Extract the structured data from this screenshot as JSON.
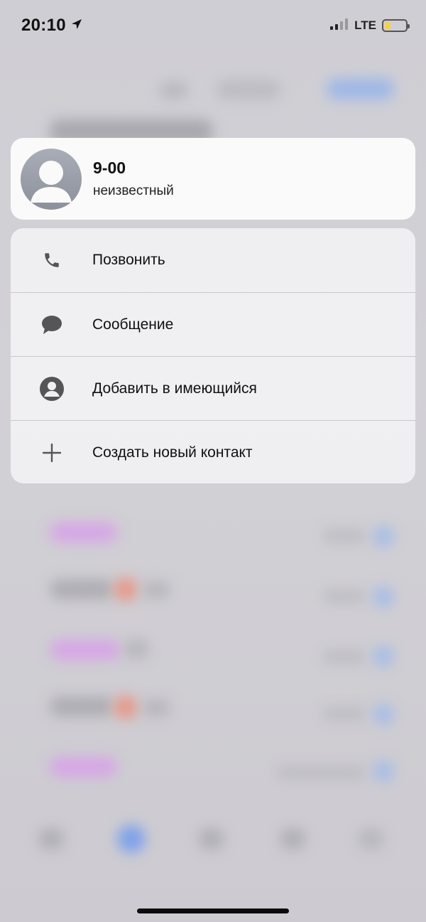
{
  "status": {
    "time": "20:10",
    "network": "LTE",
    "battery_level": 0.28,
    "icons": [
      "location-arrow-icon",
      "signal-icon",
      "battery-icon"
    ]
  },
  "contact": {
    "number": "9-00",
    "label": "неизвестный"
  },
  "menu": {
    "items": [
      {
        "icon": "phone-icon",
        "label": "Позвонить"
      },
      {
        "icon": "message-icon",
        "label": "Сообщение"
      },
      {
        "icon": "person-icon",
        "label": "Добавить в имеющийся"
      },
      {
        "icon": "plus-icon",
        "label": "Создать новый контакт"
      }
    ]
  },
  "colors": {
    "card_bg": "#fafafa",
    "menu_bg": "#f0f0f2",
    "icon": "#555555",
    "battery_fill": "#f2d24a"
  }
}
